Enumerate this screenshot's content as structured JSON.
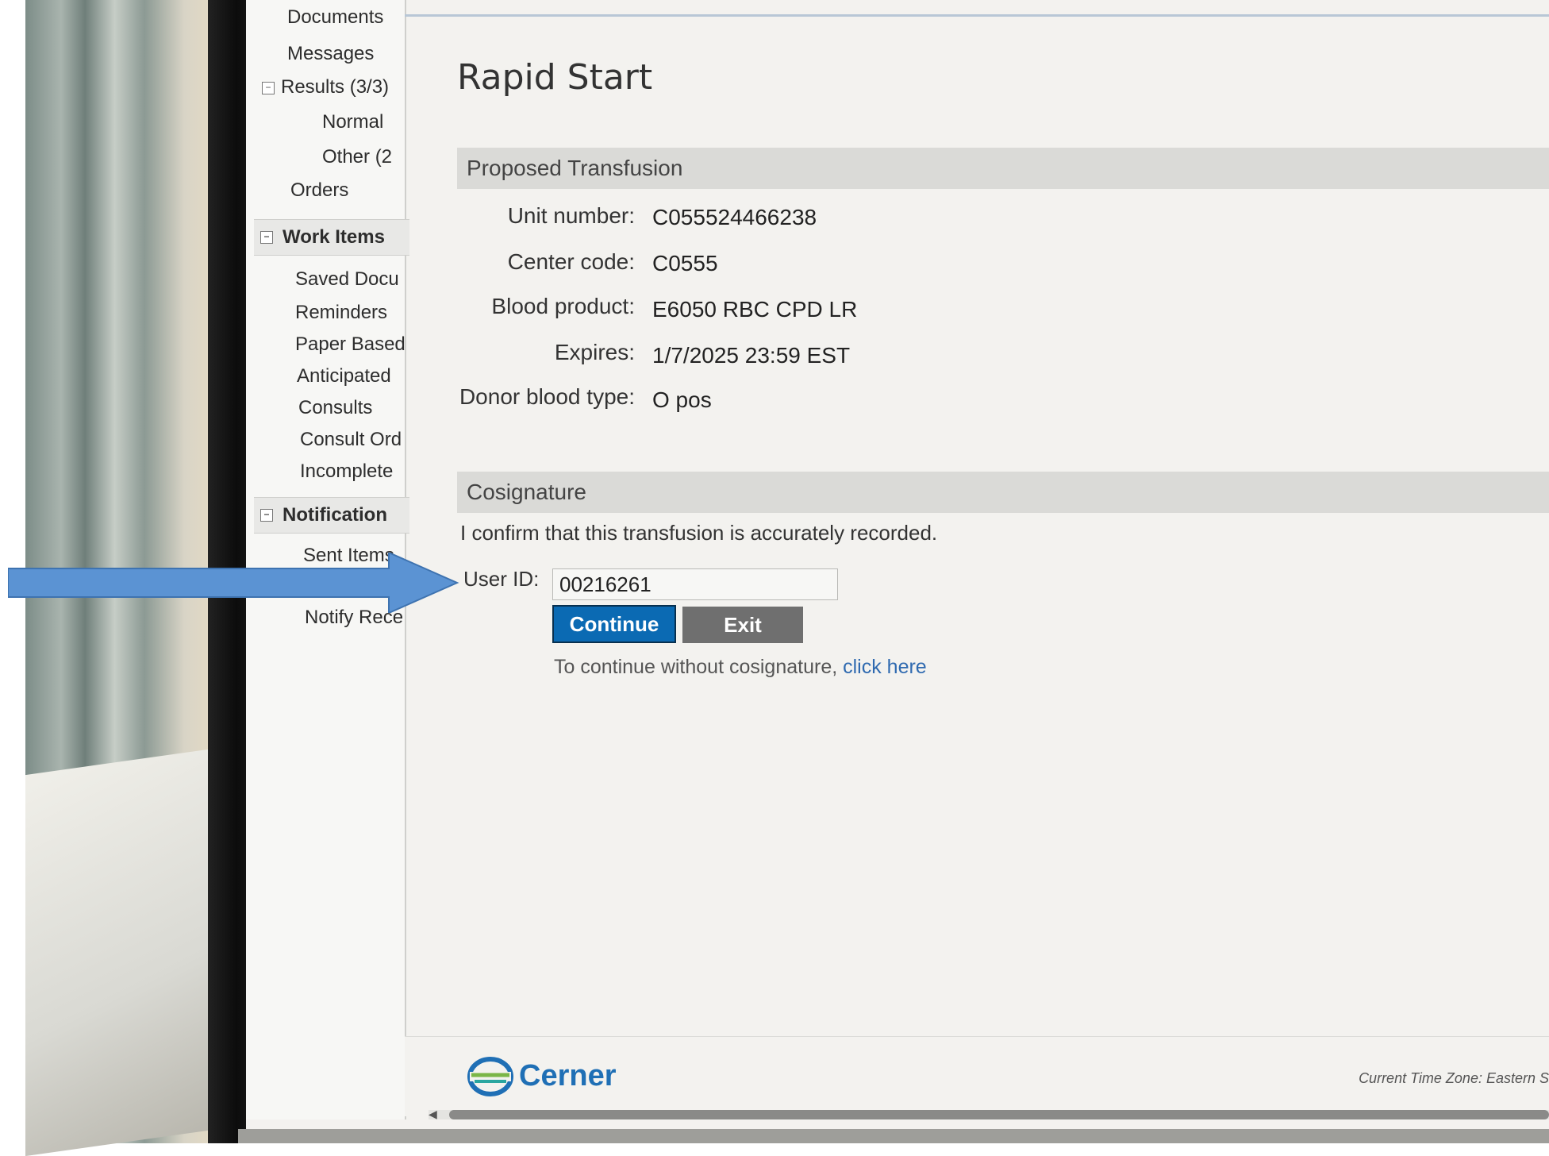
{
  "sidebar": {
    "items": [
      {
        "label": "Documents"
      },
      {
        "label": "Messages"
      },
      {
        "label": "Results (3/3)"
      },
      {
        "label": "Normal"
      },
      {
        "label": "Other (2"
      },
      {
        "label": "Orders"
      }
    ],
    "work_items": {
      "title": "Work Items",
      "items": [
        {
          "label": "Saved Docu"
        },
        {
          "label": "Reminders"
        },
        {
          "label": "Paper Based"
        },
        {
          "label": "Anticipated"
        },
        {
          "label": "Consults"
        },
        {
          "label": "Consult Ord"
        },
        {
          "label": "Incomplete"
        }
      ]
    },
    "notifications": {
      "title": "Notification",
      "items": [
        {
          "label": "Sent Items"
        },
        {
          "label": "Notify Rece"
        }
      ]
    }
  },
  "main": {
    "title": "Rapid Start",
    "proposed_transfusion": {
      "header": "Proposed Transfusion",
      "fields": [
        {
          "label": "Unit number:",
          "value": "C055524466238"
        },
        {
          "label": "Center code:",
          "value": "C0555"
        },
        {
          "label": "Blood product:",
          "value": "E6050 RBC CPD LR"
        },
        {
          "label": "Expires:",
          "value": "1/7/2025 23:59 EST"
        },
        {
          "label": "Donor blood type:",
          "value": "O pos"
        }
      ]
    },
    "cosignature": {
      "header": "Cosignature",
      "confirm_text": "I confirm that this transfusion is accurately recorded.",
      "user_id_label": "User ID:",
      "user_id_value": "00216261",
      "continue_label": "Continue",
      "exit_label": "Exit",
      "note_prefix": "To continue without cosignature,",
      "note_link": "click here"
    }
  },
  "footer": {
    "brand": "Cerner",
    "timezone": "Current Time Zone: Eastern S"
  },
  "colors": {
    "primary_button": "#0b6ab3",
    "secondary_button": "#6f6f6f",
    "link": "#2f6ab0",
    "arrow": "#5b93d3",
    "section_header": "#dadad7"
  }
}
